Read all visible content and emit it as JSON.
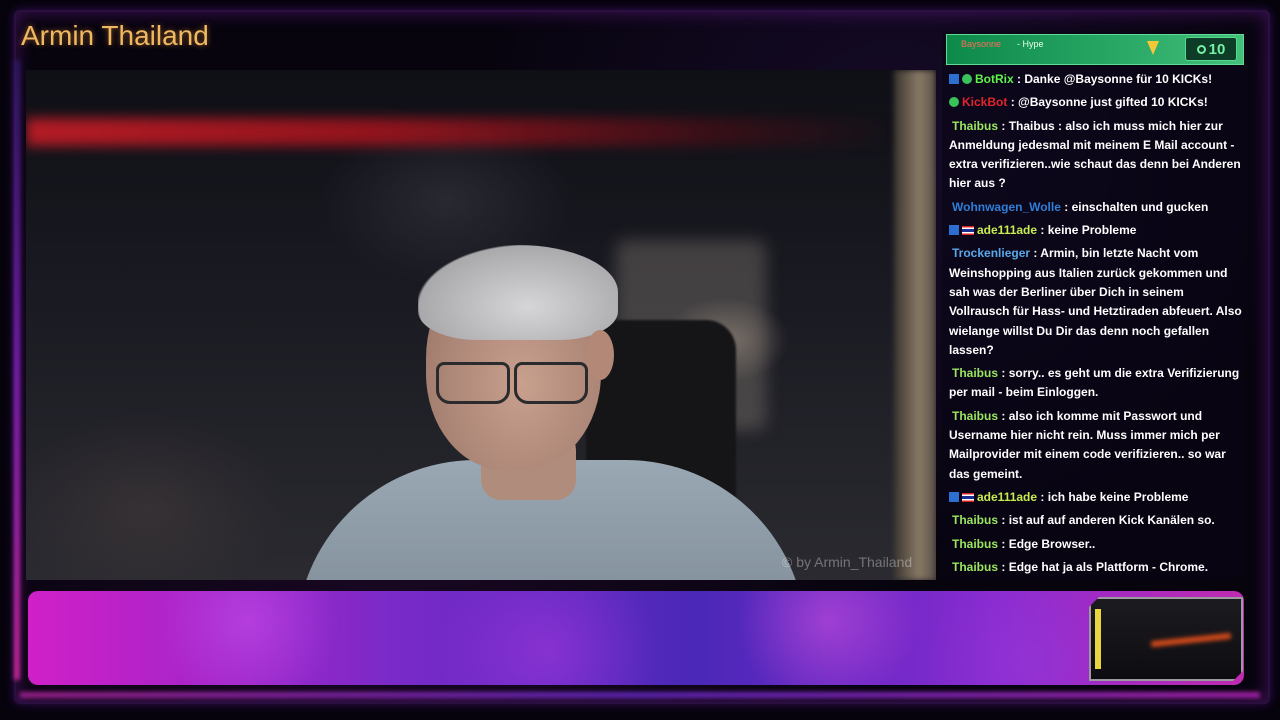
{
  "stream": {
    "title": "Armin Thailand",
    "watermark": "© by Armin_Thailand"
  },
  "hype": {
    "user": "Baysonne",
    "text": "- Hype",
    "count": "10"
  },
  "chat": [
    {
      "badges": [
        "arrow-badge",
        "check-badge"
      ],
      "user": "BotRix",
      "color": "#5ef24a",
      "text": ": Danke @Baysonne für 10 KICKs!"
    },
    {
      "badges": [
        "check-badge"
      ],
      "user": "KickBot",
      "color": "#e0242c",
      "text": ": @Baysonne just gifted 10 KICKs!"
    },
    {
      "badges": [],
      "user": "Thaibus",
      "color": "#9be65f",
      "text": ": Thaibus : also ich muss mich hier zur Anmeldung jedesmal mit meinem E Mail account - extra verifizieren..wie schaut das denn bei Anderen hier aus ?"
    },
    {
      "badges": [],
      "user": "Wohnwagen_Wolle",
      "color": "#2f7fd8",
      "text": ": einschalten und gucken"
    },
    {
      "badges": [
        "arrow-badge",
        "flag-badge"
      ],
      "user": "ade111ade",
      "color": "#c7ec50",
      "text": ": keine Probleme"
    },
    {
      "badges": [],
      "user": "Trockenlieger",
      "color": "#58a8ea",
      "text": ": Armin, bin letzte Nacht vom Weinshopping aus Italien zurück gekommen und sah was der Berliner über Dich in seinem Vollrausch für Hass- und Hetztiraden abfeuert. Also wielange willst Du Dir das denn noch gefallen lassen?"
    },
    {
      "badges": [],
      "user": "Thaibus",
      "color": "#9be65f",
      "text": ": sorry.. es geht um die extra Verifizierung per mail - beim Einloggen."
    },
    {
      "badges": [],
      "user": "Thaibus",
      "color": "#9be65f",
      "text": ": also ich komme mit Passwort und Username hier nicht rein. Muss immer mich per Mailprovider mit einem code verifizieren.. so war das gemeint."
    },
    {
      "badges": [
        "arrow-badge",
        "flag-badge"
      ],
      "user": "ade111ade",
      "color": "#c7ec50",
      "text": ": ich habe keine Probleme"
    },
    {
      "badges": [],
      "user": "Thaibus",
      "color": "#9be65f",
      "text": ": ist auf auf anderen Kick Kanälen so."
    },
    {
      "badges": [],
      "user": "Thaibus",
      "color": "#9be65f",
      "text": ": Edge Browser.."
    },
    {
      "badges": [],
      "user": "Thaibus",
      "color": "#9be65f",
      "text": ": Edge hat ja als Plattform - Chrome."
    }
  ],
  "colors": {
    "title": "#f0b860",
    "hype_bar": "#2aa866",
    "banner_accent": "#7a2ac8"
  }
}
